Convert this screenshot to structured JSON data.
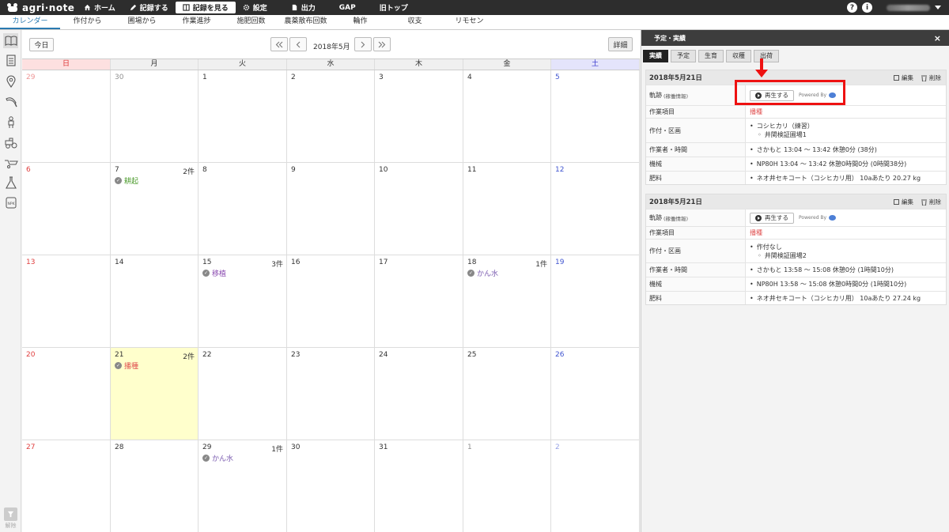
{
  "app": {
    "logo": "agri·note"
  },
  "topnav": [
    {
      "label": "ホーム",
      "icon": "home-icon"
    },
    {
      "label": "記録する",
      "icon": "pencil-icon"
    },
    {
      "label": "記録を見る",
      "icon": "book-icon",
      "active": true
    },
    {
      "label": "設定",
      "icon": "gear-icon"
    },
    {
      "label": "出力",
      "icon": "document-icon"
    },
    {
      "label": "GAP",
      "icon": ""
    },
    {
      "label": "旧トップ",
      "icon": ""
    }
  ],
  "topright": {
    "help": "?",
    "info": "i"
  },
  "subnav": [
    {
      "label": "カレンダー",
      "active": true
    },
    {
      "label": "作付から"
    },
    {
      "label": "圃場から"
    },
    {
      "label": "作業進捗"
    },
    {
      "label": "施肥回数"
    },
    {
      "label": "農薬散布回数"
    },
    {
      "label": "輪作"
    },
    {
      "label": "収支"
    },
    {
      "label": "リモセン"
    }
  ],
  "rail": {
    "icons": [
      "book-icon",
      "list-icon",
      "map-pin-icon",
      "sickle-icon",
      "worker-icon",
      "tractor-icon",
      "wheelbarrow-icon",
      "flask-icon",
      "npk-icon"
    ],
    "filter_label": "解除"
  },
  "calendar": {
    "today_button": "今日",
    "month": "2018年5月",
    "detail_button": "詳細",
    "dow": [
      "日",
      "月",
      "火",
      "水",
      "木",
      "金",
      "土"
    ],
    "weeks": [
      [
        {
          "d": "29",
          "other": true
        },
        {
          "d": "30",
          "other": true
        },
        {
          "d": "1"
        },
        {
          "d": "2"
        },
        {
          "d": "3"
        },
        {
          "d": "4"
        },
        {
          "d": "5"
        }
      ],
      [
        {
          "d": "6"
        },
        {
          "d": "7",
          "count": "2件",
          "event": "耕起",
          "event_color": "#4a9a2a"
        },
        {
          "d": "8"
        },
        {
          "d": "9"
        },
        {
          "d": "10"
        },
        {
          "d": "11"
        },
        {
          "d": "12"
        }
      ],
      [
        {
          "d": "13"
        },
        {
          "d": "14"
        },
        {
          "d": "15",
          "count": "3件",
          "event": "移植",
          "event_color": "#8a4ab0"
        },
        {
          "d": "16"
        },
        {
          "d": "17"
        },
        {
          "d": "18",
          "count": "1件",
          "event": "かん水",
          "event_color": "#7b5cb0"
        },
        {
          "d": "19"
        }
      ],
      [
        {
          "d": "20"
        },
        {
          "d": "21",
          "count": "2件",
          "event": "播種",
          "event_color": "#e05050",
          "today": true
        },
        {
          "d": "22"
        },
        {
          "d": "23"
        },
        {
          "d": "24"
        },
        {
          "d": "25"
        },
        {
          "d": "26"
        }
      ],
      [
        {
          "d": "27"
        },
        {
          "d": "28"
        },
        {
          "d": "29",
          "count": "1件",
          "event": "かん水",
          "event_color": "#7b5cb0"
        },
        {
          "d": "30"
        },
        {
          "d": "31"
        },
        {
          "d": "1",
          "other": true
        },
        {
          "d": "2",
          "other": true
        }
      ]
    ]
  },
  "panel": {
    "title": "予定・実績",
    "close": "×",
    "tabs": [
      "実績",
      "予定",
      "生育",
      "収穫",
      "出荷"
    ],
    "labels": {
      "track": "軌跡",
      "track_sub": "(稼働情報)",
      "task": "作業項目",
      "crop": "作付・区画",
      "worker": "作業者・時間",
      "machine": "機械",
      "fertilizer": "肥料"
    },
    "edit": "編集",
    "delete": "削除",
    "play": "再生する",
    "powered_by": "Powered By",
    "records": [
      {
        "date": "2018年5月21日",
        "task": "播種",
        "crop": "コシヒカリ（練習）",
        "field": "井関検証圃場1",
        "worker": "さかもと 13:04 〜 13:42 休憩0分 (38分)",
        "machine": "NP80H 13:04 〜 13:42 休憩0時間0分 (0時間38分)",
        "fertilizer": "ネオ井セキコート（コシヒカリ用） 10aあたり 20.27 kg"
      },
      {
        "date": "2018年5月21日",
        "task": "播種",
        "crop": "作付なし",
        "field": "井関検証圃場2",
        "worker": "さかもと 13:58 〜 15:08 休憩0分 (1時間10分)",
        "machine": "NP80H 13:58 〜 15:08 休憩0時間0分 (1時間10分)",
        "fertilizer": "ネオ井セキコート（コシヒカリ用） 10aあたり 27.24 kg"
      }
    ]
  },
  "colors": {
    "highlight": "#ee1111",
    "accent": "#2a7ab0",
    "today": "#ffffcc"
  }
}
